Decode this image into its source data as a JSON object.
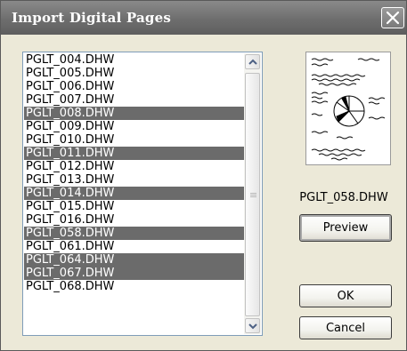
{
  "window": {
    "title": "Import Digital Pages"
  },
  "file_list": {
    "items": [
      {
        "label": "PGLT_004.DHW",
        "selected": false
      },
      {
        "label": "PGLT_005.DHW",
        "selected": false
      },
      {
        "label": "PGLT_006.DHW",
        "selected": false
      },
      {
        "label": "PGLT_007.DHW",
        "selected": false
      },
      {
        "label": "PGLT_008.DHW",
        "selected": true
      },
      {
        "label": "PGLT_009.DHW",
        "selected": false
      },
      {
        "label": "PGLT_010.DHW",
        "selected": false
      },
      {
        "label": "PGLT_011.DHW",
        "selected": true
      },
      {
        "label": "PGLT_012.DHW",
        "selected": false
      },
      {
        "label": "PGLT_013.DHW",
        "selected": false
      },
      {
        "label": "PGLT_014.DHW",
        "selected": true
      },
      {
        "label": "PGLT_015.DHW",
        "selected": false
      },
      {
        "label": "PGLT_016.DHW",
        "selected": false
      },
      {
        "label": "PGLT_058.DHW",
        "selected": true
      },
      {
        "label": "PGLT_061.DHW",
        "selected": false
      },
      {
        "label": "PGLT_064.DHW",
        "selected": true
      },
      {
        "label": "PGLT_067.DHW",
        "selected": true
      },
      {
        "label": "PGLT_068.DHW",
        "selected": false
      }
    ]
  },
  "preview": {
    "filename": "PGLT_058.DHW",
    "preview_label": "Preview"
  },
  "buttons": {
    "ok_label": "OK",
    "cancel_label": "Cancel"
  },
  "colors": {
    "selection": "#6b6b6b",
    "titlebar": "#6e6e6e",
    "dialog_bg": "#ece9d8"
  },
  "icons": {
    "close": "close-icon",
    "scroll_up": "scroll-up-icon",
    "scroll_down": "scroll-down-icon"
  }
}
